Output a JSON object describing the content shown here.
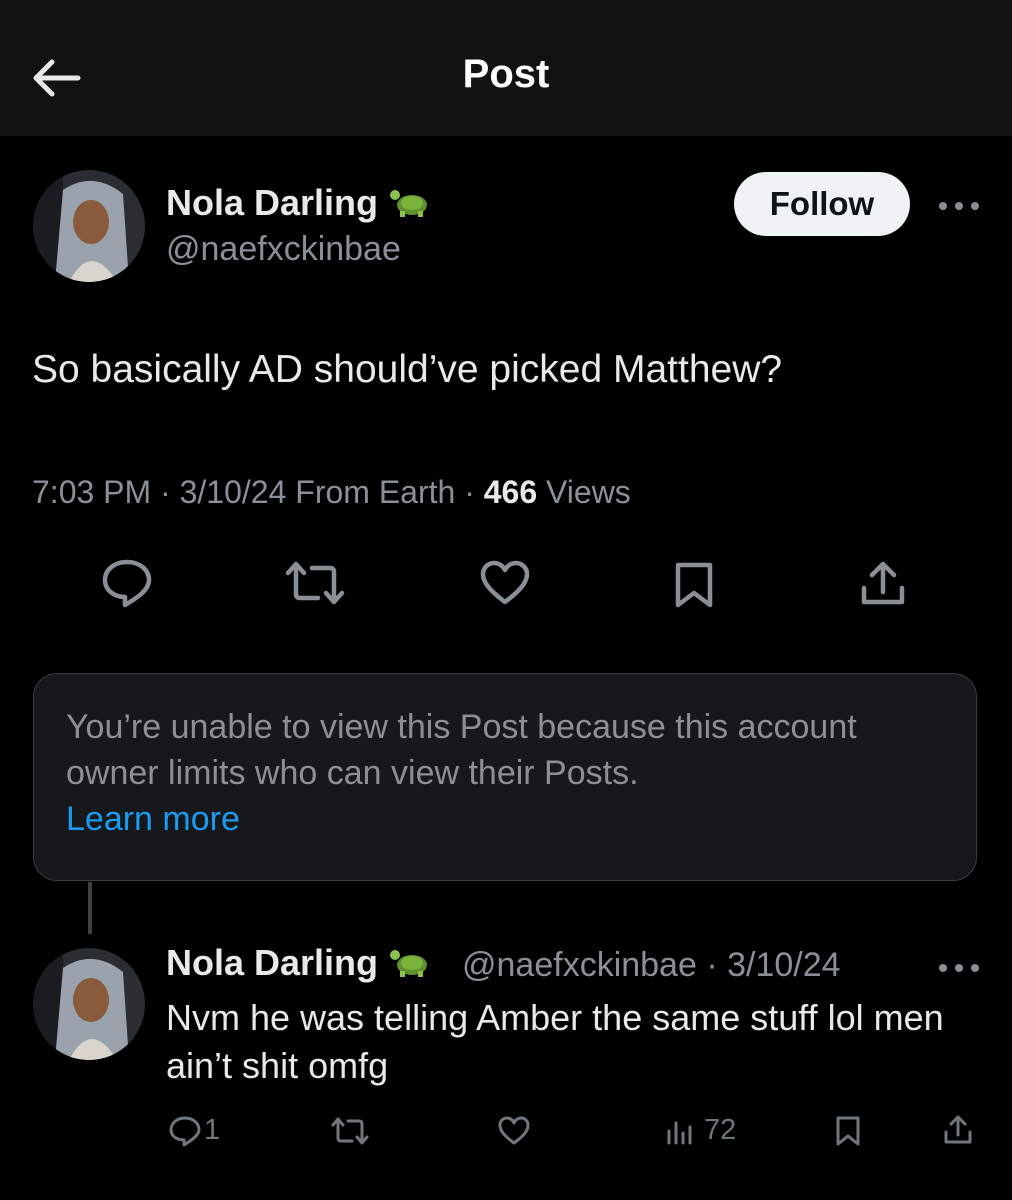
{
  "header": {
    "title": "Post"
  },
  "post": {
    "author_name": "Nola Darling",
    "author_handle": "@naefxckinbae",
    "follow_label": "Follow",
    "text": "So basically AD should’ve picked Matthew?",
    "time": "7:03 PM",
    "date": "3/10/24",
    "source": "From Earth",
    "views_count": "466",
    "views_label": "Views",
    "icons": [
      "reply-icon",
      "repost-icon",
      "like-icon",
      "bookmark-icon",
      "share-icon"
    ]
  },
  "notice": {
    "text": "You’re unable to view this Post because this account owner limits who can view their Posts.",
    "link": "Learn more"
  },
  "reply": {
    "author_name": "Nola Darling",
    "handle_date": "@naefxckinbae · 3/10/24",
    "text": "Nvm he was telling Amber the same stuff lol men ain’t shit omfg",
    "reply_count": "1",
    "views_count": "72",
    "icons": [
      "reply-icon",
      "repost-icon",
      "like-icon",
      "views-icon",
      "bookmark-icon",
      "share-icon"
    ]
  },
  "colors": {
    "link": "#1d9bf0",
    "muted": "#8b9096",
    "background": "#000000",
    "header": "#121212"
  }
}
